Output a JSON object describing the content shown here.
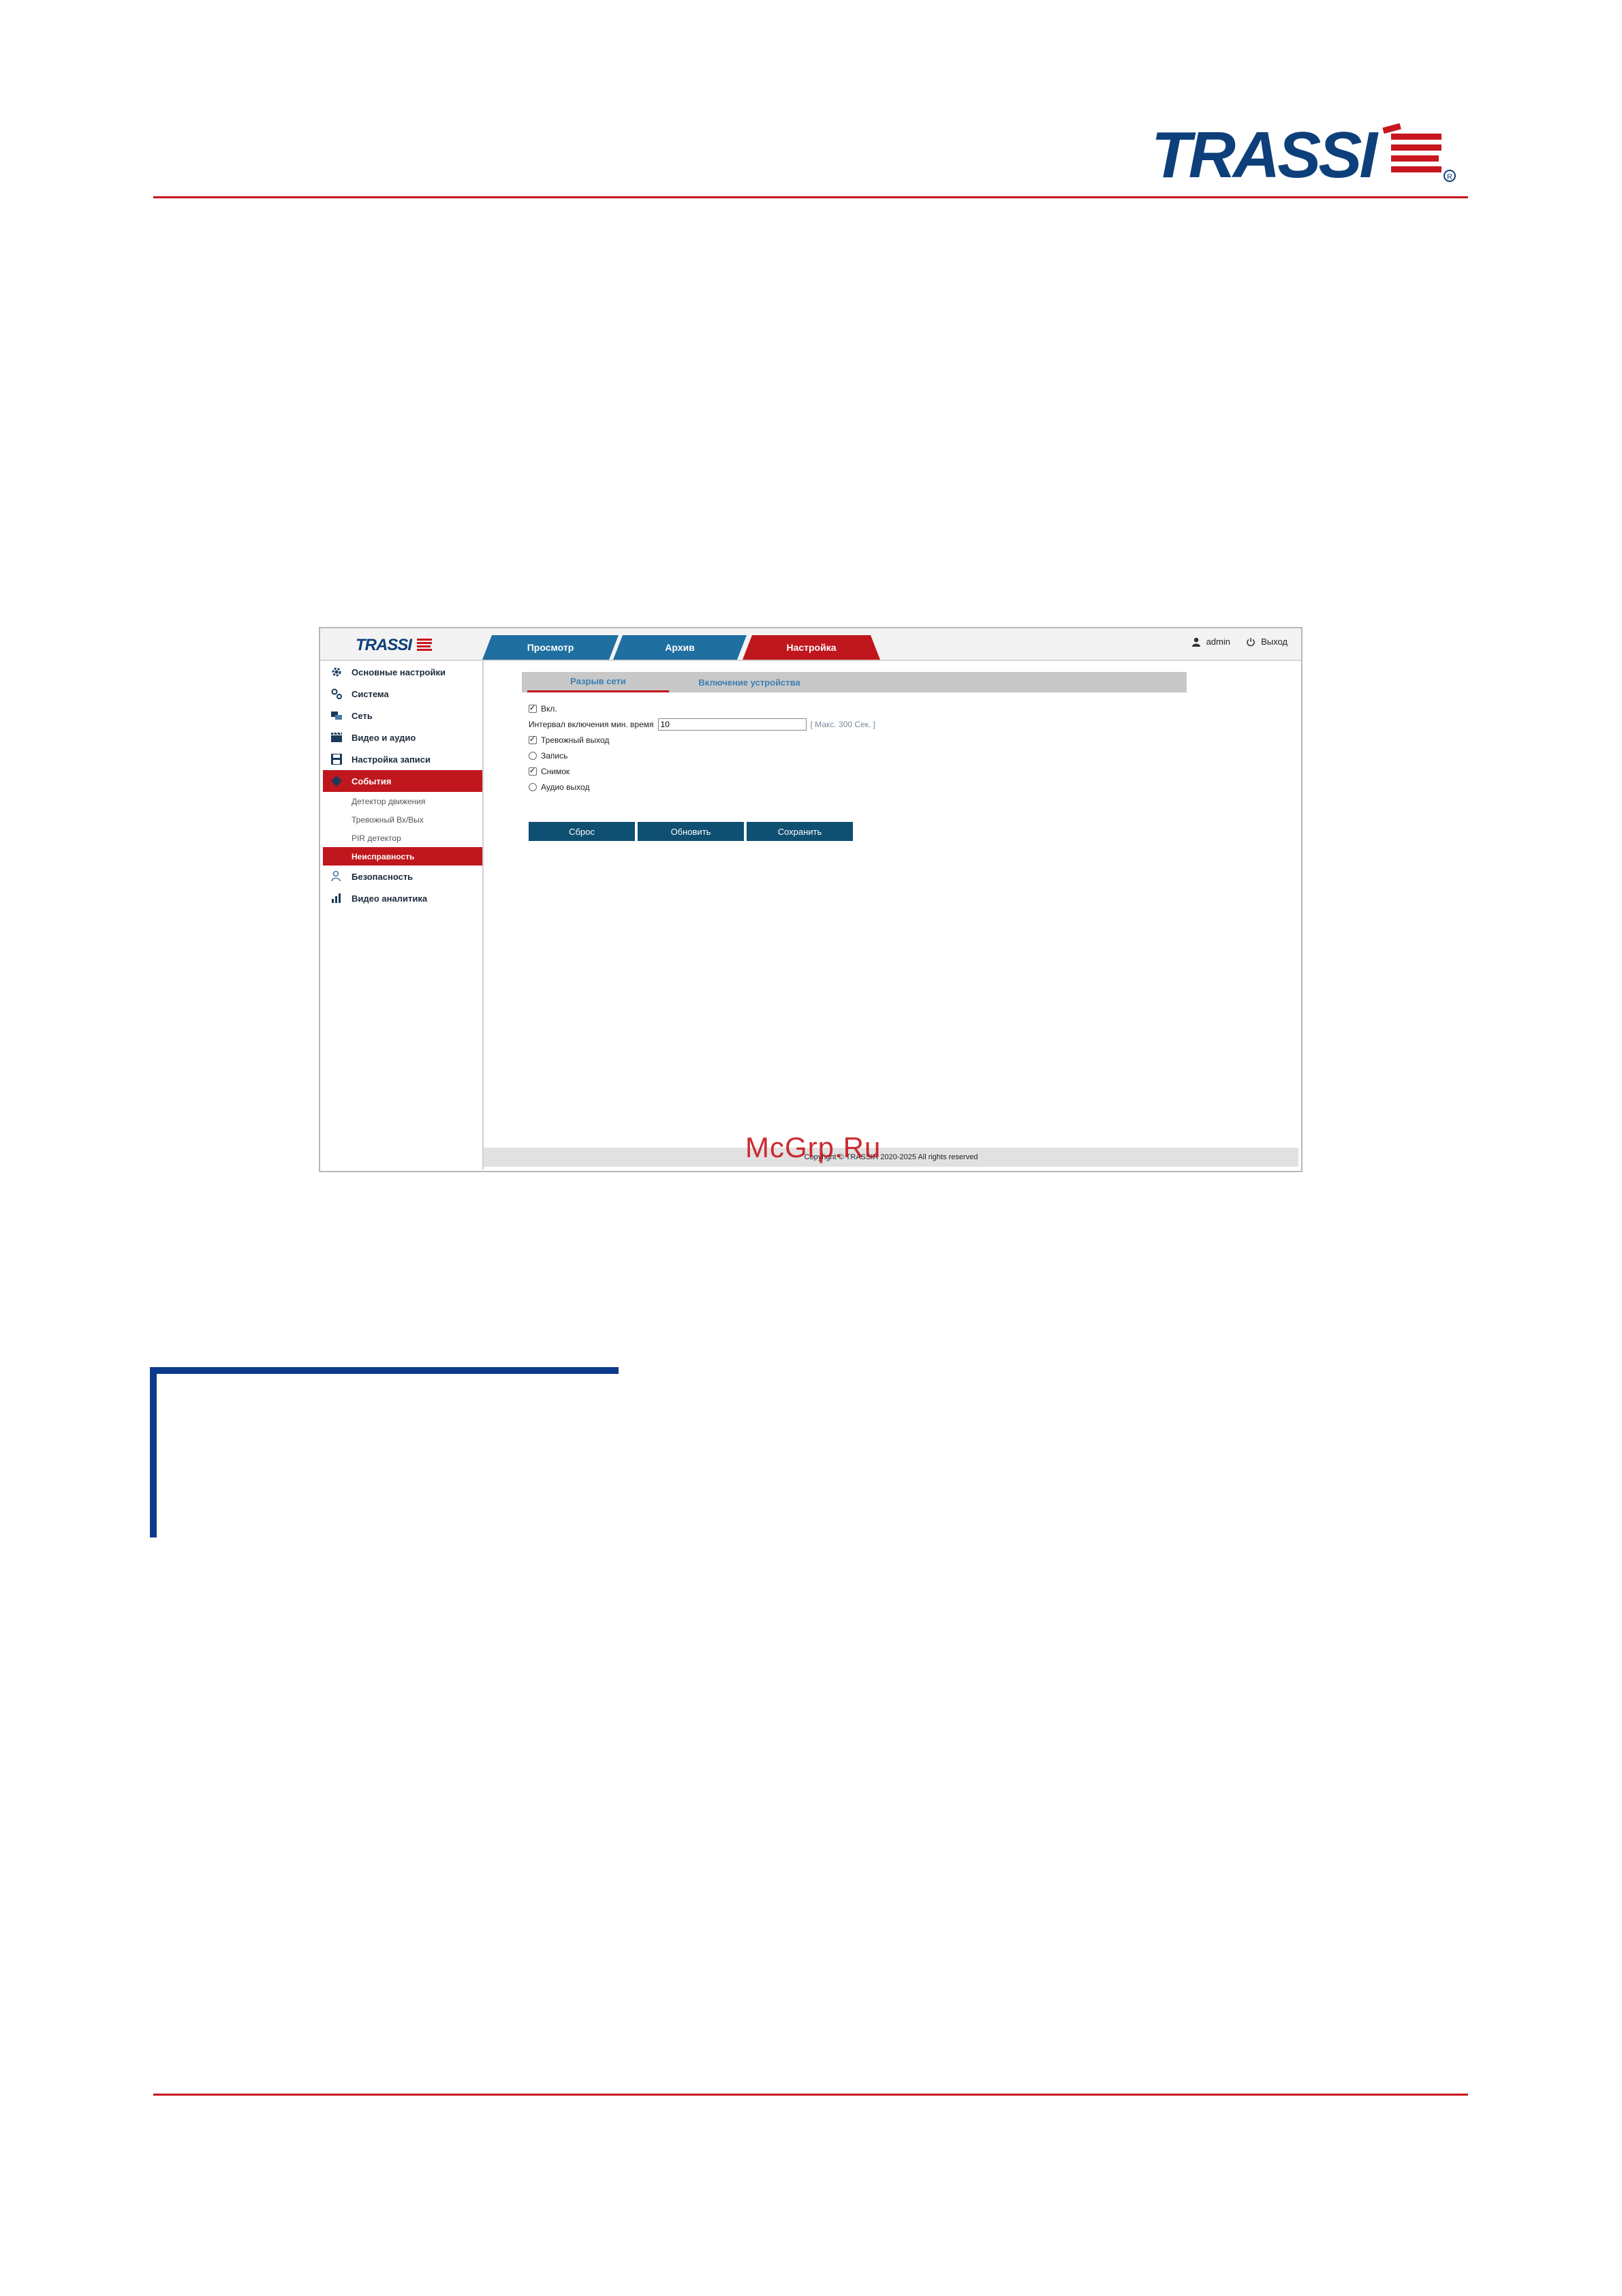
{
  "brand": {
    "name": "TRASSIR",
    "accent": "#c8161e",
    "navy": "#0c3a8a"
  },
  "watermark": "McGrp.Ru",
  "app": {
    "tabs": [
      {
        "label": "Просмотр"
      },
      {
        "label": "Архив"
      },
      {
        "label": "Настройка"
      }
    ],
    "user": "admin",
    "exit_label": "Выход",
    "sidebar": {
      "items": [
        {
          "label": "Основные настройки",
          "icon": "gear-icon"
        },
        {
          "label": "Система",
          "icon": "gears-icon"
        },
        {
          "label": "Сеть",
          "icon": "network-icon"
        },
        {
          "label": "Видео и аудио",
          "icon": "clapper-icon"
        },
        {
          "label": "Настройка записи",
          "icon": "disk-icon"
        },
        {
          "label": "События",
          "icon": "events-icon"
        }
      ],
      "sub_items": [
        {
          "label": "Детектор движения"
        },
        {
          "label": "Тревожный Вх/Вых"
        },
        {
          "label": "PIR детектор"
        },
        {
          "label": "Неисправность"
        }
      ],
      "items_after": [
        {
          "label": "Безопасность",
          "icon": "user-shield-icon"
        },
        {
          "label": "Видео аналитика",
          "icon": "chart-icon"
        }
      ]
    },
    "subtabs": [
      {
        "label": "Разрыв сети"
      },
      {
        "label": "Включение устройства"
      }
    ],
    "form": {
      "enable_label": "Вкл.",
      "interval_label": "Интервал включения мин. время",
      "interval_value": "10",
      "interval_hint": "[ Макс. 300 Сек. ]",
      "alarm_out_label": "Тревожный выход",
      "record_label": "Запись",
      "snapshot_label": "Снимок",
      "audio_out_label": "Аудио выход"
    },
    "buttons": {
      "reset": "Сброс",
      "refresh": "Обновить",
      "save": "Сохранить"
    },
    "footer": "Copyright © TRASSIR 2020-2025 All rights reserved"
  }
}
